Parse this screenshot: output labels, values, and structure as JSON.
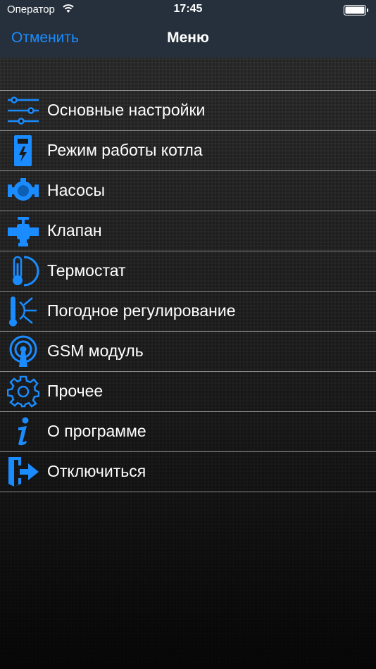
{
  "status_bar": {
    "carrier": "Оператор",
    "time": "17:45"
  },
  "navbar": {
    "cancel_label": "Отменить",
    "title": "Меню"
  },
  "accent_color": "#1a8cff",
  "menu": {
    "items": [
      {
        "label": "Основные настройки",
        "icon": "sliders-icon"
      },
      {
        "label": "Режим работы котла",
        "icon": "boiler-icon"
      },
      {
        "label": "Насосы",
        "icon": "pump-icon"
      },
      {
        "label": "Клапан",
        "icon": "valve-icon"
      },
      {
        "label": "Термостат",
        "icon": "thermostat-icon"
      },
      {
        "label": "Погодное регулирование",
        "icon": "weather-sensor-icon"
      },
      {
        "label": "GSM модуль",
        "icon": "antenna-icon"
      },
      {
        "label": "Прочее",
        "icon": "gear-icon"
      },
      {
        "label": "О программе",
        "icon": "info-icon"
      },
      {
        "label": "Отключиться",
        "icon": "logout-icon"
      }
    ]
  }
}
